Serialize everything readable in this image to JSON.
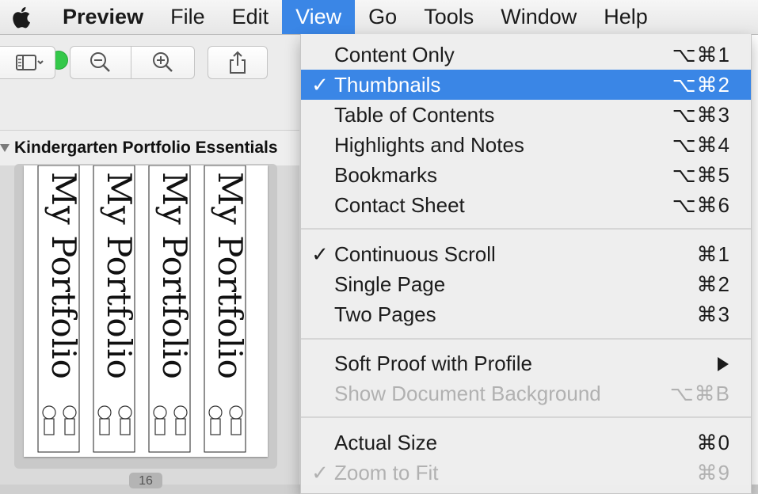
{
  "menubar": {
    "app_name": "Preview",
    "items": [
      "File",
      "Edit",
      "View",
      "Go",
      "Tools",
      "Window",
      "Help"
    ]
  },
  "window": {
    "document_title": "Kindergarten Portfolio Essentials",
    "page_badge": "16",
    "thumbnail_text": "My Portfolio"
  },
  "view_menu": {
    "items": [
      {
        "label": "Content Only",
        "shortcut": "⌥⌘1",
        "checked": false,
        "state": "normal"
      },
      {
        "label": "Thumbnails",
        "shortcut": "⌥⌘2",
        "checked": true,
        "state": "highlighted"
      },
      {
        "label": "Table of Contents",
        "shortcut": "⌥⌘3",
        "checked": false,
        "state": "normal"
      },
      {
        "label": "Highlights and Notes",
        "shortcut": "⌥⌘4",
        "checked": false,
        "state": "normal"
      },
      {
        "label": "Bookmarks",
        "shortcut": "⌥⌘5",
        "checked": false,
        "state": "normal"
      },
      {
        "label": "Contact Sheet",
        "shortcut": "⌥⌘6",
        "checked": false,
        "state": "normal"
      },
      {
        "label": "Continuous Scroll",
        "shortcut": "⌘1",
        "checked": true,
        "state": "normal"
      },
      {
        "label": "Single Page",
        "shortcut": "⌘2",
        "checked": false,
        "state": "normal"
      },
      {
        "label": "Two Pages",
        "shortcut": "⌘3",
        "checked": false,
        "state": "normal"
      },
      {
        "label": "Soft Proof with Profile",
        "shortcut": "",
        "checked": false,
        "state": "submenu"
      },
      {
        "label": "Show Document Background",
        "shortcut": "⌥⌘B",
        "checked": false,
        "state": "disabled"
      },
      {
        "label": "Actual Size",
        "shortcut": "⌘0",
        "checked": false,
        "state": "normal"
      },
      {
        "label": "Zoom to Fit",
        "shortcut": "⌘9",
        "checked": true,
        "state": "disabled"
      }
    ],
    "check_glyph": "✓"
  },
  "colors": {
    "menu_highlight": "#3a86e6",
    "close": "#fc605c",
    "minimize": "#fdbc40",
    "zoom": "#34c84a"
  }
}
